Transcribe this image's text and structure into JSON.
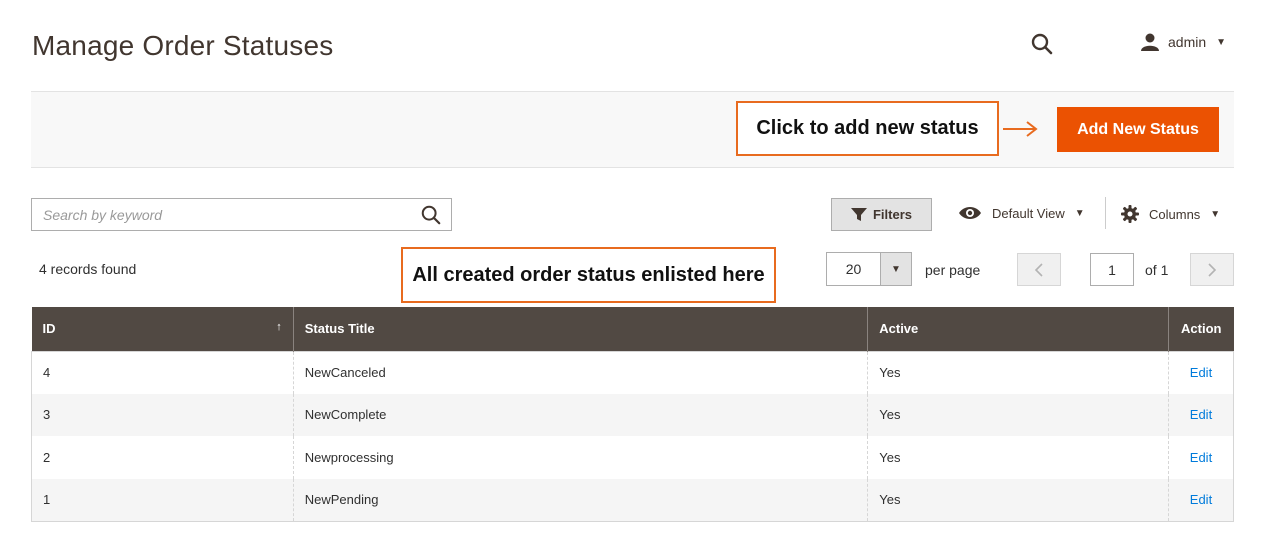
{
  "header": {
    "title": "Manage Order Statuses",
    "user": "admin"
  },
  "actions": {
    "add_button": "Add New Status",
    "add_callout": "Click to add new status"
  },
  "toolbar": {
    "search_placeholder": "Search by keyword",
    "filters_label": "Filters",
    "view_label": "Default View",
    "columns_label": "Columns",
    "records_found": "4 records found",
    "list_callout": "All created order status enlisted here",
    "per_page_value": "20",
    "per_page_label": "per page",
    "page_current": "1",
    "page_of": "of 1"
  },
  "grid": {
    "columns": [
      "ID",
      "Status Title",
      "Active",
      "Action"
    ],
    "rows": [
      {
        "id": "4",
        "title": "NewCanceled",
        "active": "Yes",
        "action": "Edit"
      },
      {
        "id": "3",
        "title": "NewComplete",
        "active": "Yes",
        "action": "Edit"
      },
      {
        "id": "2",
        "title": "Newprocessing",
        "active": "Yes",
        "action": "Edit"
      },
      {
        "id": "1",
        "title": "NewPending",
        "active": "Yes",
        "action": "Edit"
      }
    ]
  },
  "colors": {
    "accent": "#eb5202",
    "callout_border": "#e86b1f",
    "grid_header": "#514943",
    "link": "#007bdb"
  },
  "icons": {
    "header_search": "search-icon",
    "user": "user-icon",
    "arrow": "arrow-right-icon",
    "filter": "funnel-icon",
    "view": "eye-icon",
    "columns": "gear-icon"
  }
}
